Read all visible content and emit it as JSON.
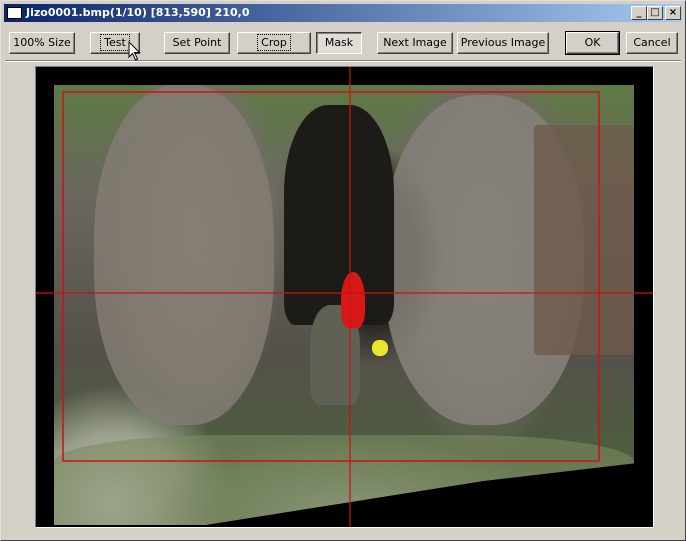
{
  "window": {
    "title": "Jizo0001.bmp(1/10) [813,590] 210,0",
    "controls": {
      "minimize": "_",
      "maximize": "□",
      "close": "×"
    }
  },
  "toolbar": {
    "size_100": "100% Size",
    "test": "Test",
    "set_point": "Set Point",
    "crop": "Crop",
    "mask": "Mask",
    "next_image": "Next Image",
    "previous_image": "Previous Image",
    "ok": "OK",
    "cancel": "Cancel"
  },
  "colors": {
    "title_start": "#0a246a",
    "title_end": "#a6caf0",
    "guide_line": "#d01010",
    "face": "#d4d0c8"
  },
  "icons": {
    "title": "window-app-icon",
    "cursor": "mouse-pointer-icon"
  }
}
